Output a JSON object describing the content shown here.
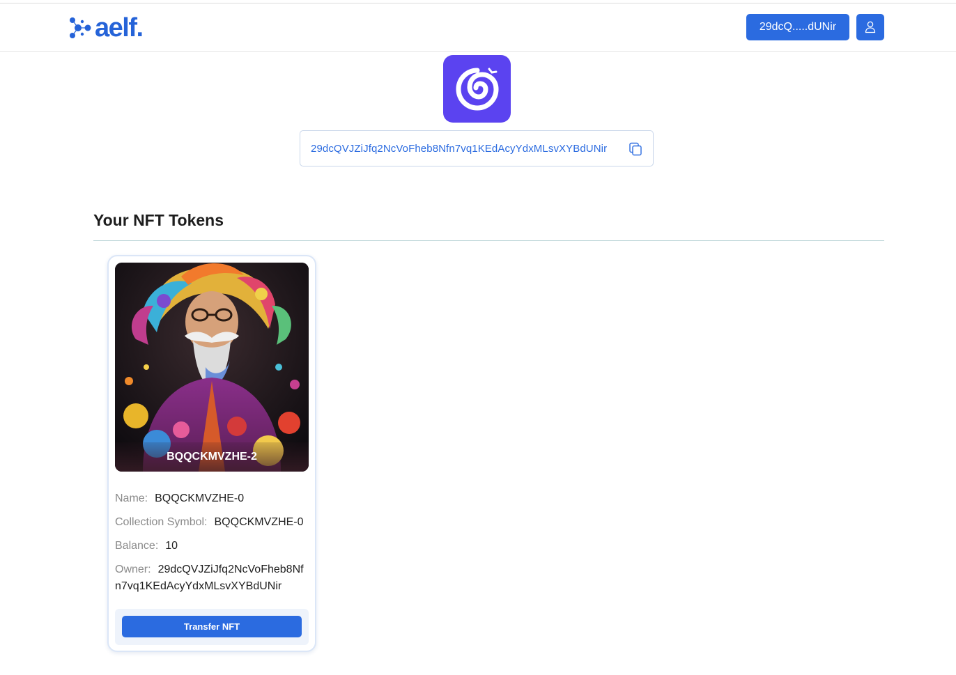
{
  "header": {
    "logo_text": "aelf.",
    "wallet_button_label": "29dcQ.....dUNir",
    "profile_icon": "user-icon"
  },
  "profile": {
    "app_icon": "spiral-icon",
    "address": "29dcQVJZiJfq2NcVoFheb8Nfn7vq1KEdAcyYdxMLsvXYBdUNir",
    "copy_icon": "copy-icon"
  },
  "section": {
    "title": "Your NFT Tokens"
  },
  "nfts": [
    {
      "caption": "BQQCKMVZHE-2",
      "name_label": "Name:",
      "name_value": "BQQCKMVZHE-0",
      "collection_label": "Collection Symbol:",
      "collection_value": "BQQCKMVZHE-0",
      "balance_label": "Balance:",
      "balance_value": "10",
      "owner_label": "Owner:",
      "owner_value": "29dcQVJZiJfq2NcVoFheb8Nfn7vq1KEdAcyYdxMLsvXYBdUNir",
      "transfer_label": "Transfer NFT"
    }
  ],
  "colors": {
    "primary": "#2b6be0",
    "app_icon_bg": "#5b43f0",
    "divider": "#b9d3d6"
  }
}
